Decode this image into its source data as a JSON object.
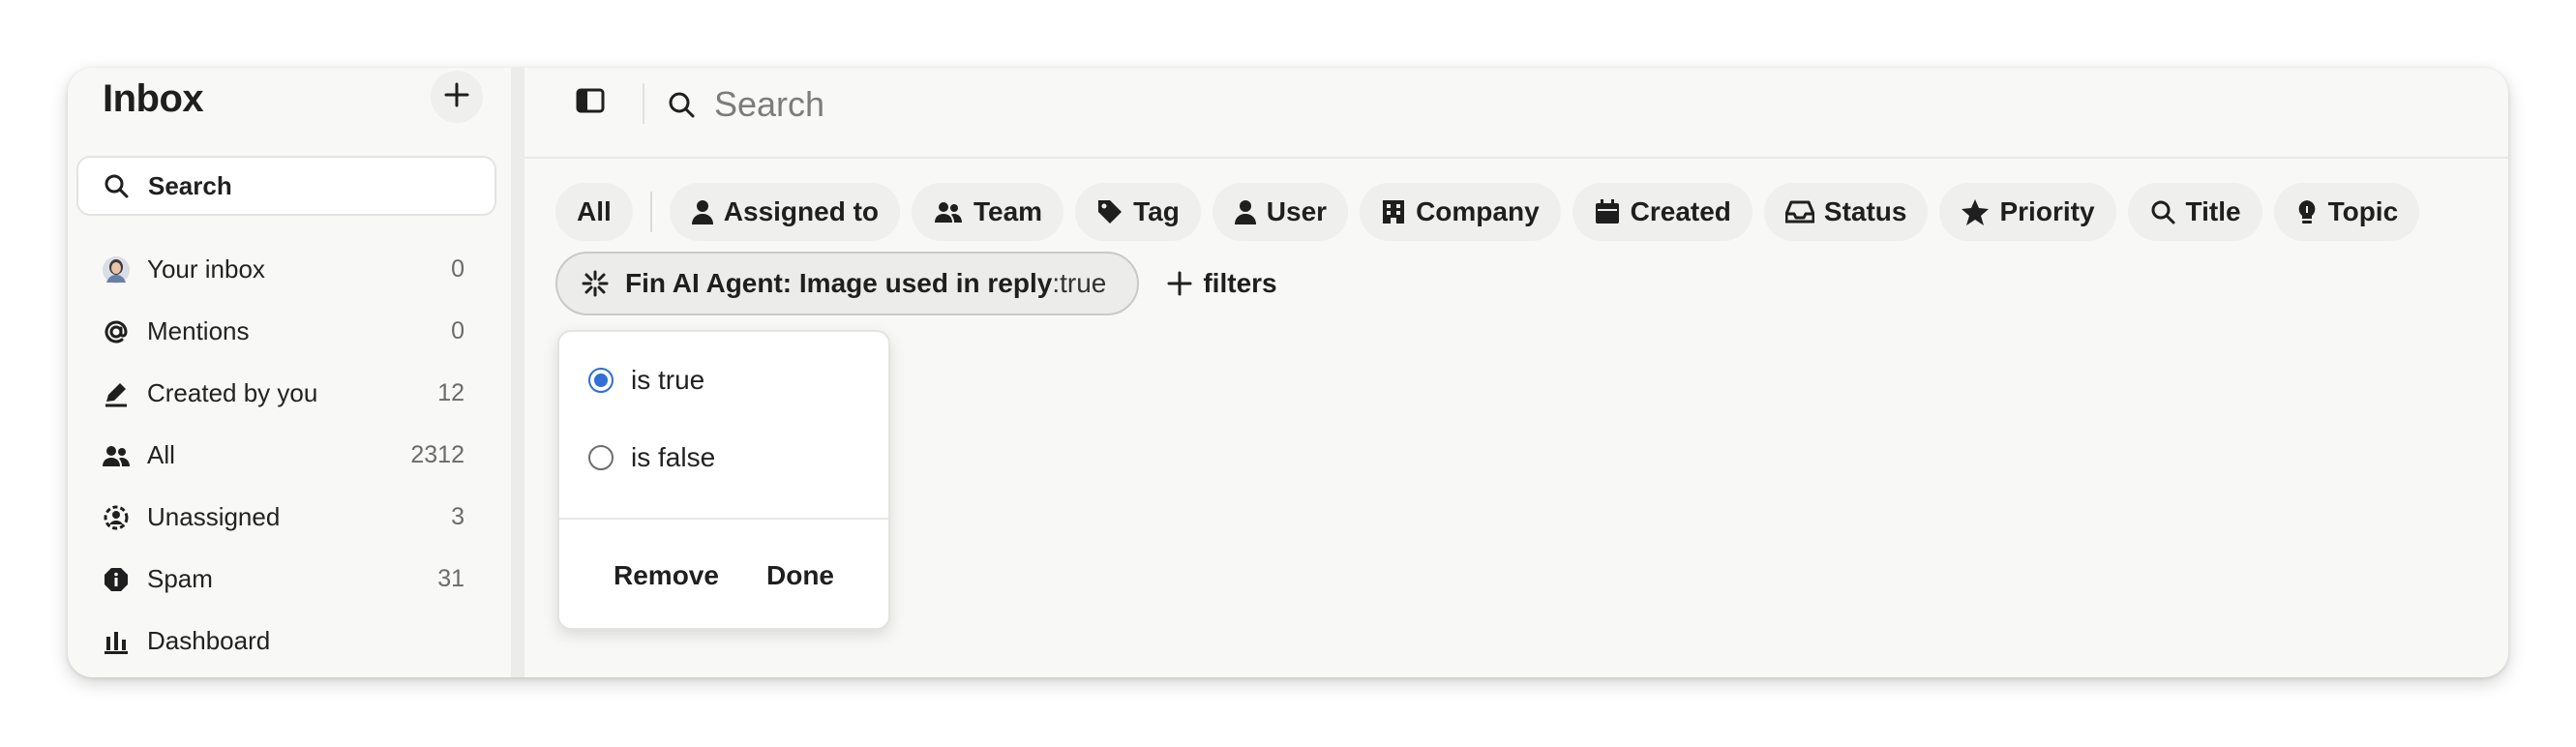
{
  "sidebar": {
    "title": "Inbox",
    "search_label": "Search",
    "items": [
      {
        "icon": "avatar",
        "label": "Your inbox",
        "count": "0"
      },
      {
        "icon": "at-icon",
        "label": "Mentions",
        "count": "0"
      },
      {
        "icon": "pencil-icon",
        "label": "Created by you",
        "count": "12"
      },
      {
        "icon": "people-icon",
        "label": "All",
        "count": "2312"
      },
      {
        "icon": "unassigned-icon",
        "label": "Unassigned",
        "count": "3"
      },
      {
        "icon": "spam-icon",
        "label": " Spam",
        "count": "31"
      },
      {
        "icon": "bar-chart-icon",
        "label": "Dashboard",
        "count": ""
      }
    ]
  },
  "topbar": {
    "search_placeholder": "Search"
  },
  "chips": {
    "all": "All",
    "assigned_to": "Assigned to",
    "team": "Team",
    "tag": "Tag",
    "user": "User",
    "company": "Company",
    "created": "Created",
    "status": "Status",
    "priority": "Priority",
    "title": "Title",
    "topic": "Topic"
  },
  "active_filter": {
    "name": "Fin AI Agent: Image used in reply",
    "separator": ": ",
    "value": "true"
  },
  "add_filters_label": "filters",
  "popover": {
    "option_true": "is true",
    "option_false": "is false",
    "selected": "is true",
    "remove_label": "Remove",
    "done_label": "Done"
  },
  "colors": {
    "accent": "#2f6fd6",
    "window_bg": "#f8f8f6",
    "chip_bg": "#efefed"
  }
}
